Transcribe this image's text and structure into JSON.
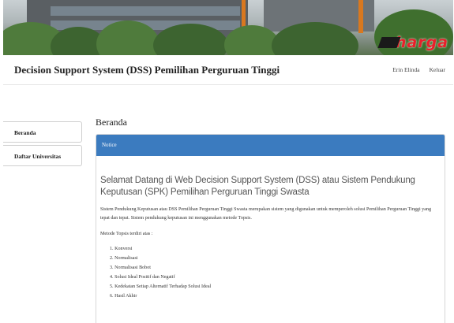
{
  "header": {
    "app_title": "Decision Support System (DSS) Pemilihan Perguruan Tinggi",
    "user_name": "Erin Elinda",
    "logout_label": "Keluar"
  },
  "banner": {
    "logo_text": "harga"
  },
  "sidebar": {
    "items": [
      {
        "label": "Beranda"
      },
      {
        "label": "Daftar Universitas"
      }
    ]
  },
  "main": {
    "page_title": "Beranda",
    "panel_heading": "Notice",
    "welcome": "Selamat Datang di Web Decision Support System (DSS) atau Sistem Pendukung Keputusan (SPK) Pemilihan Perguruan Tinggi Swasta",
    "paragraph": "Sistem Pendukung Keputusan atau DSS Pemilihan Perguruan Tinggi Swasta merupakan sistem yang digunakan untuk memperoleh solusi Pemilihan Perguruan Tinggi yang tepat dan tepat. Sistem pendukung keputusan ini menggunakan metode Topsis.",
    "method_intro": "Metode Topsis terdiri atas :",
    "steps": [
      "1. Konversi",
      "2. Normalisasi",
      "3. Normalisasi Bobot",
      "4. Solusi Ideal Positif dan Negatif",
      "5. Kedekatan Setiap Alternatif Terhadap Solusi Ideal",
      "6. Hasil Akhir"
    ]
  },
  "colors": {
    "panel_header": "#3b7bbf",
    "logo_red": "#e8202a"
  }
}
